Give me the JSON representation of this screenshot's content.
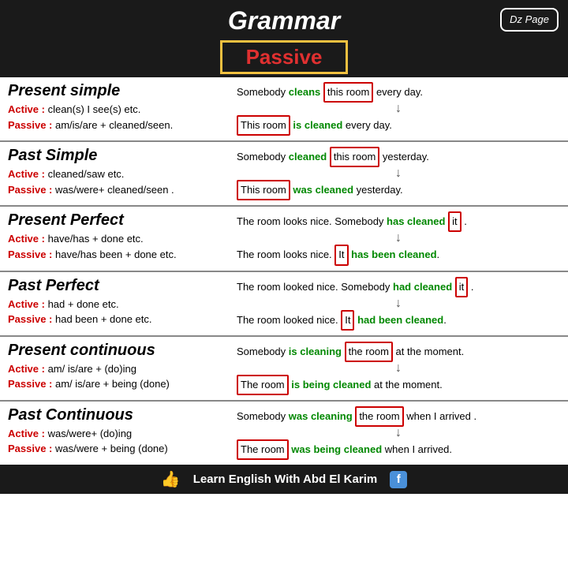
{
  "header": {
    "title": "Grammar",
    "passive_label": "Passive",
    "dz_label": "Dz Page"
  },
  "sections": [
    {
      "id": "present-simple",
      "title": "Present simple",
      "active_rule": "Active : clean(s) I see(s) etc.",
      "passive_rule": "Passive : am/is/are + cleaned/seen.",
      "example_active": "Somebody",
      "example_active_verb": "cleans",
      "example_active_obj": "this room",
      "example_active_end": "every day.",
      "example_passive_subj": "This room",
      "example_passive_verb": "is cleaned",
      "example_passive_end": "every day."
    },
    {
      "id": "past-simple",
      "title": "Past Simple",
      "active_rule": "Active : cleaned/saw etc.",
      "passive_rule": "Passive : was/were+ cleaned/seen .",
      "example_active_pre": "Somebody",
      "example_active_verb": "cleaned",
      "example_active_obj": "this room",
      "example_active_end": "yesterday.",
      "example_passive_subj": "This room",
      "example_passive_verb": "was cleaned",
      "example_passive_end": "yesterday."
    },
    {
      "id": "present-perfect",
      "title": "Present Perfect",
      "active_rule": "Active :  have/has + done etc.",
      "passive_rule": "Passive : have/has been + done etc.",
      "example_active": "The room looks nice. Somebody",
      "example_active_verb": "has cleaned",
      "example_active_obj": "it",
      "example_active_end": ".",
      "example_passive_pre": "The room looks nice.",
      "example_passive_subj": "It",
      "example_passive_verb": "has been cleaned",
      "example_passive_end": "."
    },
    {
      "id": "past-perfect",
      "title": "Past Perfect",
      "active_rule": "Active :  had + done etc.",
      "passive_rule": "Passive : had been + done etc.",
      "example_active": "The room looked nice. Somebody",
      "example_active_verb": "had cleaned",
      "example_active_obj": "it",
      "example_active_end": ".",
      "example_passive_pre": "The room looked nice.",
      "example_passive_subj": "It",
      "example_passive_verb": "had been cleaned",
      "example_passive_end": "."
    },
    {
      "id": "present-continuous",
      "title": "Present continuous",
      "active_rule": "Active : am/ is/are + (do)ing",
      "passive_rule": "Passive : am/ is/are + being (done)",
      "example_active_pre": "Somebody",
      "example_active_verb": "is cleaning",
      "example_active_obj": "the room",
      "example_active_end": "at the moment.",
      "example_passive_subj": "The room",
      "example_passive_verb": "is being cleaned",
      "example_passive_end": "at the moment."
    },
    {
      "id": "past-continuous",
      "title": "Past Continuous",
      "active_rule": "Active : was/were+ (do)ing",
      "passive_rule": "Passive : was/were + being (done)",
      "example_active_pre": "Somebody",
      "example_active_verb": "was cleaning",
      "example_active_obj": "the room",
      "example_active_end": "when I arrived .",
      "example_passive_subj": "The room",
      "example_passive_verb": "was being cleaned",
      "example_passive_end": "when I arrived."
    }
  ],
  "footer": {
    "text": "Learn English With Abd El Karim"
  }
}
